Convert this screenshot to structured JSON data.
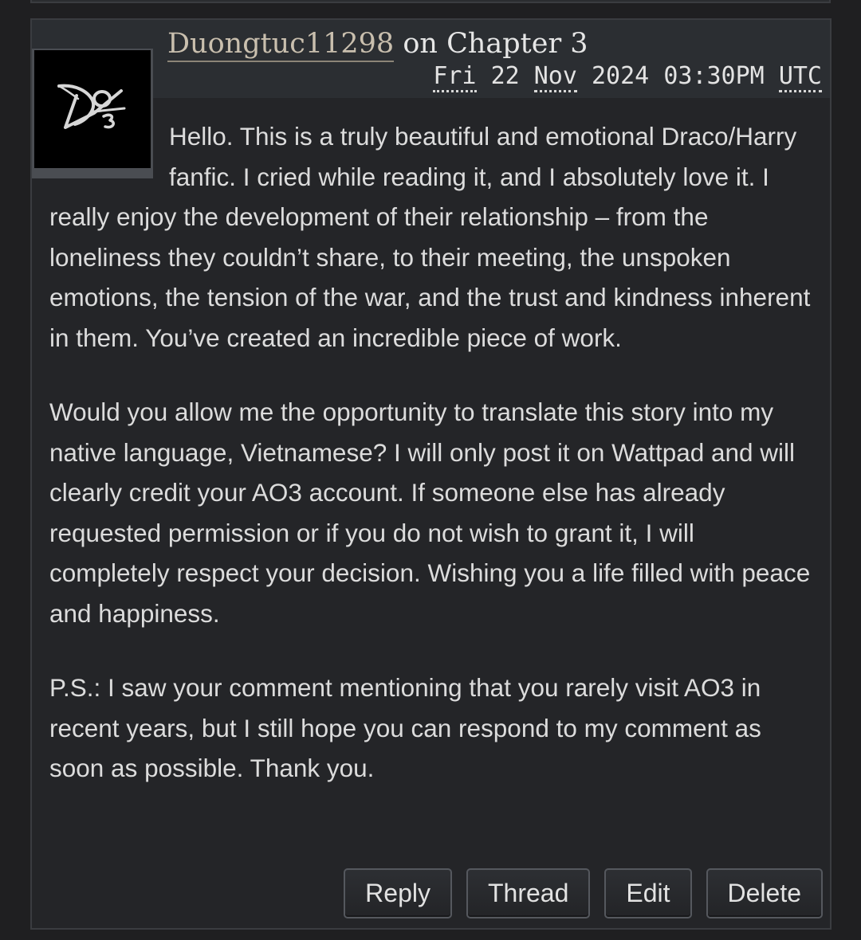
{
  "comment": {
    "author": "Duongtuc11298",
    "on_text": "on",
    "chapter": "Chapter 3",
    "date": {
      "weekday": "Fri",
      "day": "22",
      "month": "Nov",
      "year": "2024",
      "time": "03:30PM",
      "timezone": "UTC"
    },
    "avatar": {
      "icon": "ao3-logo-icon",
      "alt_text": "AO3"
    },
    "paragraphs": [
      "Hello. This is a truly beautiful and emotional Draco/Harry fanfic. I cried while reading it, and I absolutely love it. I really enjoy the development of their relationship – from the loneliness they couldn’t share, to their meeting, the unspoken emotions, the tension of the war, and the trust and kindness inherent in them. You’ve created an incredible piece of work.",
      "Would you allow me the opportunity to translate this story into my native language, Vietnamese? I will only post it on Wattpad and will clearly credit your AO3 account. If someone else has already requested permission or if you do not wish to grant it, I will completely respect your decision. Wishing you a life filled with peace and happiness.",
      "P.S.: I saw your comment mentioning that you rarely visit AO3 in recent years, but I still hope you can respond to my comment as soon as possible. Thank you."
    ]
  },
  "actions": {
    "reply": "Reply",
    "thread": "Thread",
    "edit": "Edit",
    "delete": "Delete"
  },
  "colors": {
    "page_background": "#1f1f21",
    "card_background": "#242528",
    "header_background": "#2b2e32",
    "border": "#3a3c40",
    "author_link": "#c9bfae",
    "body_text": "#dcdcdc"
  }
}
